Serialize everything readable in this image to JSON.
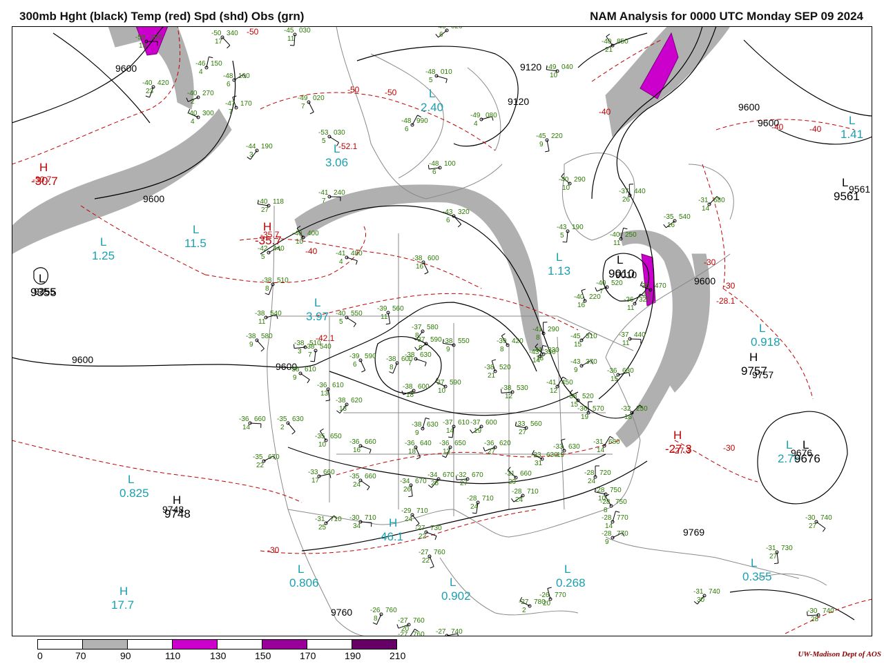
{
  "header": {
    "title_left": "300mb Hght (black) Temp (red) Spd (shd) Obs (grn)",
    "title_right": "NAM Analysis for 0000 UTC Monday  SEP 09 2024"
  },
  "legend": {
    "labels": [
      "0",
      "70",
      "90",
      "110",
      "130",
      "150",
      "170",
      "190",
      "210"
    ],
    "fills": [
      "#ffffff",
      "#b2b2b2",
      "#ffffff",
      "#cc00cc",
      "#ffffff",
      "#990099",
      "#ffffff",
      "#660066"
    ]
  },
  "credit": "UW-Madison  Dept of AOS",
  "colors": {
    "height": "#000000",
    "temp": "#c00000",
    "speed": "#b0b0b0",
    "jet": "#cc00cc",
    "obs": "#2a7a00",
    "centers": "#1aa0b0",
    "border": "#8a8a8a"
  },
  "height_labels": [
    "9600",
    "9600",
    "9600",
    "9600",
    "9600",
    "9600",
    "9120",
    "9120",
    "9600",
    "9561",
    "9355",
    "9010",
    "9757",
    "9748",
    "9676",
    "9769",
    "9760"
  ],
  "temp_labels": [
    "-50",
    "-50",
    "-50",
    "-40",
    "-40",
    "-40",
    "-30",
    "-30",
    "-30",
    "-30",
    "-30.7",
    "-35.7",
    "-27.3",
    "-28.1",
    "-52.1",
    "-42.1",
    "-40"
  ],
  "centers": [
    {
      "t": "H",
      "v": "-30.7",
      "c": "#c00000"
    },
    {
      "t": "L",
      "v": "1.25",
      "c": "#1aa0b0"
    },
    {
      "t": "L",
      "v": "11.5",
      "c": "#1aa0b0"
    },
    {
      "t": "H",
      "v": "-35.7",
      "c": "#c00000"
    },
    {
      "t": "L",
      "v": "2.40",
      "c": "#1aa0b0"
    },
    {
      "t": "L",
      "v": "3.06",
      "c": "#1aa0b0"
    },
    {
      "t": "L",
      "v": "3.97",
      "c": "#1aa0b0"
    },
    {
      "t": "L",
      "v": "1.13",
      "c": "#1aa0b0"
    },
    {
      "t": "L",
      "v": "1.41",
      "c": "#1aa0b0"
    },
    {
      "t": "L",
      "v": "0.918",
      "c": "#1aa0b0"
    },
    {
      "t": "L",
      "v": "0.825",
      "c": "#1aa0b0"
    },
    {
      "t": "H",
      "v": "46.1",
      "c": "#1aa0b0"
    },
    {
      "t": "L",
      "v": "0.806",
      "c": "#1aa0b0"
    },
    {
      "t": "L",
      "v": "0.902",
      "c": "#1aa0b0"
    },
    {
      "t": "L",
      "v": "0.268",
      "c": "#1aa0b0"
    },
    {
      "t": "H",
      "v": "17.7",
      "c": "#1aa0b0"
    },
    {
      "t": "L",
      "v": "2.76",
      "c": "#1aa0b0"
    },
    {
      "t": "L",
      "v": "0.355",
      "c": "#1aa0b0"
    },
    {
      "t": "H",
      "v": "-27.3",
      "c": "#c00000"
    },
    {
      "t": "H",
      "v": "9748",
      "c": "#000000"
    },
    {
      "t": "H",
      "v": "9757",
      "c": "#000000"
    },
    {
      "t": "L",
      "v": "9355",
      "c": "#000000"
    },
    {
      "t": "L",
      "v": "9561",
      "c": "#000000"
    },
    {
      "t": "L",
      "v": "9676",
      "c": "#000000"
    },
    {
      "t": "L",
      "v": "9010",
      "c": "#000000"
    }
  ],
  "obs": [
    {
      "t": "-50",
      "h": "260",
      "d": "19"
    },
    {
      "t": "-50",
      "h": "340",
      "d": "17"
    },
    {
      "t": "-45",
      "h": "030",
      "d": "11"
    },
    {
      "t": "-46",
      "h": "020",
      "d": "6"
    },
    {
      "t": "-49",
      "h": "040",
      "d": "10"
    },
    {
      "t": "-40",
      "h": "850",
      "d": "21"
    },
    {
      "t": "-46",
      "h": "150",
      "d": "4"
    },
    {
      "t": "-48",
      "h": "100",
      "d": "6"
    },
    {
      "t": "-48",
      "h": "010",
      "d": "5"
    },
    {
      "t": "-49",
      "h": "020",
      "d": "7"
    },
    {
      "t": "-40",
      "h": "420",
      "d": "23"
    },
    {
      "t": "-40",
      "h": "270",
      "d": "2"
    },
    {
      "t": "-40",
      "h": "300",
      "d": "4"
    },
    {
      "t": "-47",
      "h": "170",
      "d": "7"
    },
    {
      "t": "-48",
      "h": "990",
      "d": "6"
    },
    {
      "t": "-49",
      "h": "080",
      "d": "4"
    },
    {
      "t": "-53",
      "h": "030",
      "d": "5"
    },
    {
      "t": "-45",
      "h": "220",
      "d": "9"
    },
    {
      "t": "-44",
      "h": "190",
      "d": "3"
    },
    {
      "t": "-48",
      "h": "100",
      "d": "6"
    },
    {
      "t": "-40",
      "h": "290",
      "d": "10"
    },
    {
      "t": "-37",
      "h": "440",
      "d": "26"
    },
    {
      "t": "-31",
      "h": "680",
      "d": "14"
    },
    {
      "t": "-41",
      "h": "240",
      "d": "7"
    },
    {
      "t": "-43",
      "h": "320",
      "d": "6"
    },
    {
      "t": "-43",
      "h": "190",
      "d": "5"
    },
    {
      "t": "-35",
      "h": "540",
      "d": "16"
    },
    {
      "t": "-40",
      "h": "118",
      "d": "27"
    },
    {
      "t": "-40",
      "h": "400",
      "d": "10"
    },
    {
      "t": "-40",
      "h": "250",
      "d": "11"
    },
    {
      "t": "-42",
      "h": "440",
      "d": "5"
    },
    {
      "t": "-41",
      "h": "480",
      "d": "4"
    },
    {
      "t": "-38",
      "h": "600",
      "d": "16"
    },
    {
      "t": "-38",
      "h": "510",
      "d": "8"
    },
    {
      "t": "-40",
      "h": "520",
      "d": "7"
    },
    {
      "t": "-35",
      "h": "470",
      "d": "13"
    },
    {
      "t": "-40",
      "h": "220",
      "d": "16"
    },
    {
      "t": "-36",
      "h": "320",
      "d": "11"
    },
    {
      "t": "-38",
      "h": "540",
      "d": "11"
    },
    {
      "t": "-40",
      "h": "550",
      "d": "5"
    },
    {
      "t": "-39",
      "h": "560",
      "d": "11"
    },
    {
      "t": "-37",
      "h": "580",
      "d": "8"
    },
    {
      "t": "-38",
      "h": "510",
      "d": "3"
    },
    {
      "t": "-41",
      "h": "330",
      "d": "18"
    },
    {
      "t": "-41",
      "h": "290",
      "d": "8"
    },
    {
      "t": "-45",
      "h": "310",
      "d": "15"
    },
    {
      "t": "-37",
      "h": "440",
      "d": "11"
    },
    {
      "t": "-38",
      "h": "580",
      "d": "9"
    },
    {
      "t": "-38",
      "h": "540",
      "d": "7"
    },
    {
      "t": "-37",
      "h": "590",
      "d": "8"
    },
    {
      "t": "-38",
      "h": "550",
      "d": "9"
    },
    {
      "t": "-39",
      "h": "420",
      "d": "8"
    },
    {
      "t": "-43",
      "h": "330",
      "d": "14"
    },
    {
      "t": "-43",
      "h": "370",
      "d": "9"
    },
    {
      "t": "-38",
      "h": "630",
      "d": "7"
    },
    {
      "t": "-39",
      "h": "590",
      "d": "6"
    },
    {
      "t": "-38",
      "h": "600",
      "d": "8"
    },
    {
      "t": "-38",
      "h": "600",
      "d": "18"
    },
    {
      "t": "-37",
      "h": "590",
      "d": "10"
    },
    {
      "t": "-38",
      "h": "520",
      "d": "21"
    },
    {
      "t": "-41",
      "h": "450",
      "d": "12"
    },
    {
      "t": "-36",
      "h": "630",
      "d": "15"
    },
    {
      "t": "-38",
      "h": "610",
      "d": "9"
    },
    {
      "t": "-36",
      "h": "610",
      "d": "13"
    },
    {
      "t": "-38",
      "h": "620",
      "d": "13"
    },
    {
      "t": "-38",
      "h": "530",
      "d": "12"
    },
    {
      "t": "-38",
      "h": "520",
      "d": "15"
    },
    {
      "t": "-36",
      "h": "570",
      "d": "19"
    },
    {
      "t": "-32",
      "h": "250",
      "d": "18"
    },
    {
      "t": "-36",
      "h": "660",
      "d": "14"
    },
    {
      "t": "-35",
      "h": "630",
      "d": "2"
    },
    {
      "t": "-37",
      "h": "610",
      "d": "14"
    },
    {
      "t": "-37",
      "h": "600",
      "d": "19"
    },
    {
      "t": "-33",
      "h": "560",
      "d": "27"
    },
    {
      "t": "-35",
      "h": "650",
      "d": "10"
    },
    {
      "t": "-38",
      "h": "630",
      "d": "9"
    },
    {
      "t": "-35",
      "h": "670",
      "d": "22"
    },
    {
      "t": "-36",
      "h": "660",
      "d": "16"
    },
    {
      "t": "-36",
      "h": "640",
      "d": "18"
    },
    {
      "t": "-36",
      "h": "650",
      "d": "13"
    },
    {
      "t": "-36",
      "h": "620",
      "d": "27"
    },
    {
      "t": "-33",
      "h": "630",
      "d": "31"
    },
    {
      "t": "-33",
      "h": "630",
      "d": "19"
    },
    {
      "t": "-31",
      "h": "680",
      "d": "14"
    },
    {
      "t": "-33",
      "h": "660",
      "d": "17"
    },
    {
      "t": "-35",
      "h": "660",
      "d": "24"
    },
    {
      "t": "-34",
      "h": "670",
      "d": "26"
    },
    {
      "t": "-34",
      "h": "670",
      "d": "28"
    },
    {
      "t": "-32",
      "h": "670",
      "d": "27"
    },
    {
      "t": "-31",
      "h": "660",
      "d": "29"
    },
    {
      "t": "-28",
      "h": "720",
      "d": "24"
    },
    {
      "t": "-31",
      "h": "710",
      "d": "25"
    },
    {
      "t": "-30",
      "h": "710",
      "d": "34"
    },
    {
      "t": "-29",
      "h": "710",
      "d": "24"
    },
    {
      "t": "-28",
      "h": "710",
      "d": "24"
    },
    {
      "t": "-28",
      "h": "710",
      "d": "24"
    },
    {
      "t": "-28",
      "h": "750",
      "d": "10"
    },
    {
      "t": "-28",
      "h": "750",
      "d": "8"
    },
    {
      "t": "-28",
      "h": "770",
      "d": "14"
    },
    {
      "t": "-28",
      "h": "770",
      "d": "9"
    },
    {
      "t": "-27",
      "h": "730",
      "d": "22"
    },
    {
      "t": "-27",
      "h": "760",
      "d": "22"
    },
    {
      "t": "-26",
      "h": "760",
      "d": "8"
    },
    {
      "t": "-27",
      "h": "760",
      "d": "20"
    },
    {
      "t": "-27",
      "h": "780",
      "d": "2"
    },
    {
      "t": "-26",
      "h": "770",
      "d": "20"
    },
    {
      "t": "-27",
      "h": "760",
      "d": "17"
    },
    {
      "t": "-27",
      "h": "740",
      "d": "17"
    },
    {
      "t": "-30",
      "h": "740",
      "d": "27"
    },
    {
      "t": "-31",
      "h": "730",
      "d": "27"
    },
    {
      "t": "-31",
      "h": "740",
      "d": "30"
    },
    {
      "t": "-30",
      "h": "740",
      "d": "28"
    }
  ]
}
